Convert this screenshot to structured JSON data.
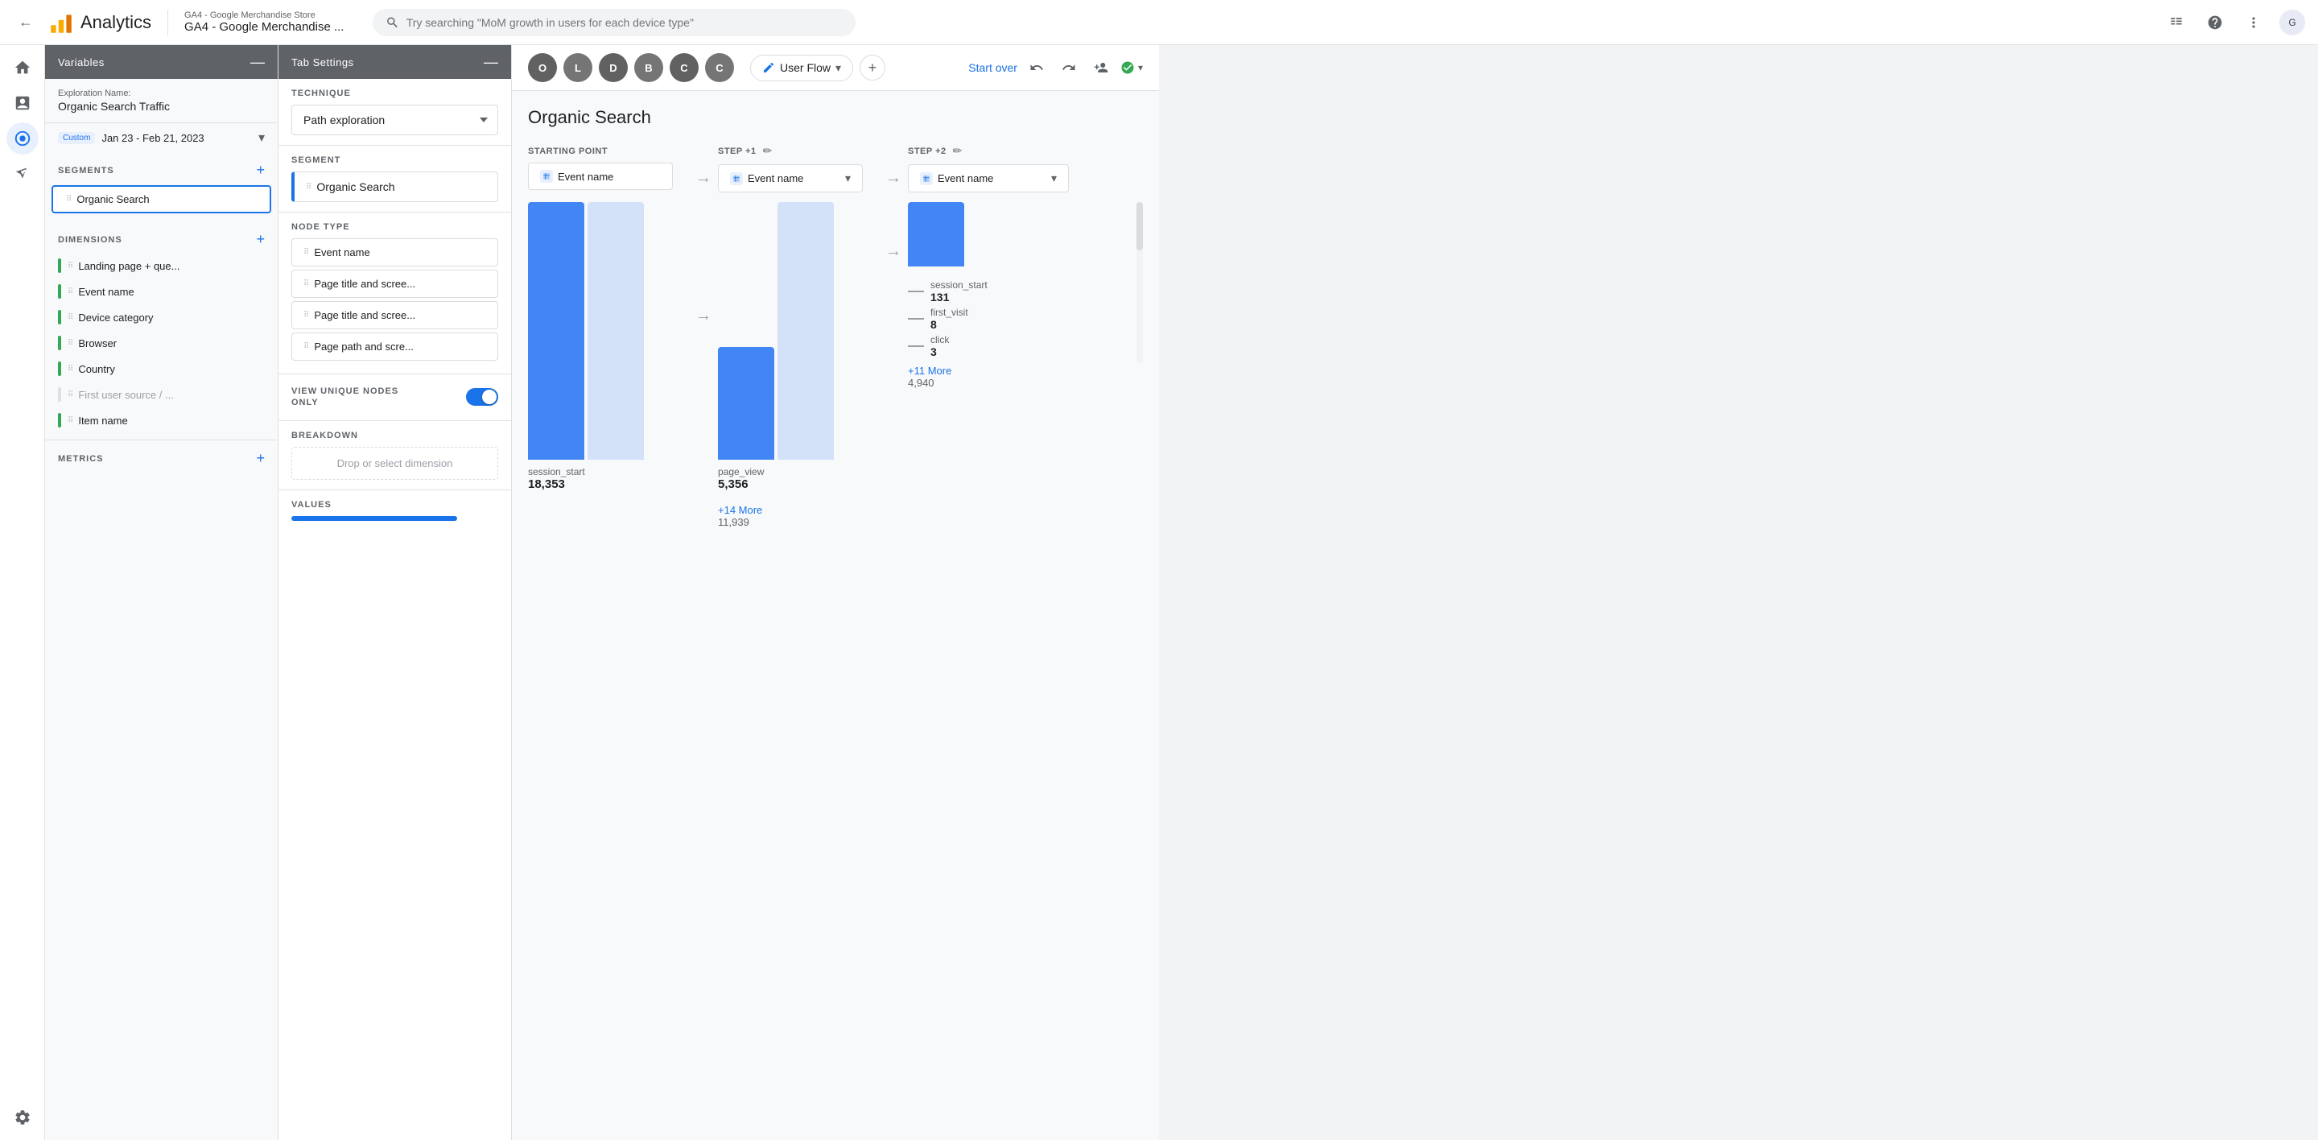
{
  "topNav": {
    "backLabel": "←",
    "logoAlt": "Analytics logo",
    "appTitle": "Analytics",
    "accountName": "GA4 - Google Merchandise Store",
    "propertyName": "GA4 - Google Merchandise ...",
    "searchPlaceholder": "Try searching \"MoM growth in users for each device type\"",
    "icons": {
      "grid": "⊞",
      "help": "?",
      "more": "⋮"
    }
  },
  "leftSidebar": {
    "items": [
      {
        "name": "home",
        "icon": "⌂",
        "active": false
      },
      {
        "name": "reports",
        "icon": "📊",
        "active": false
      },
      {
        "name": "explore",
        "icon": "○",
        "active": true
      },
      {
        "name": "advertising",
        "icon": "📡",
        "active": false
      },
      {
        "name": "admin",
        "icon": "⚙",
        "active": false
      }
    ]
  },
  "variablesPanel": {
    "title": "Variables",
    "minimizeLabel": "—",
    "explorationNameLabel": "Exploration Name:",
    "explorationNameValue": "Organic Search Traffic",
    "dateRange": {
      "badge": "Custom",
      "value": "Jan 23 - Feb 21, 2023"
    },
    "segments": {
      "title": "SEGMENTS",
      "items": [
        {
          "label": "Organic Search",
          "active": true
        }
      ]
    },
    "dimensions": {
      "title": "DIMENSIONS",
      "items": [
        {
          "label": "Landing page + que...",
          "muted": false
        },
        {
          "label": "Event name",
          "muted": false
        },
        {
          "label": "Device category",
          "muted": false
        },
        {
          "label": "Browser",
          "muted": false
        },
        {
          "label": "Country",
          "muted": false
        },
        {
          "label": "First user source / ...",
          "muted": true
        },
        {
          "label": "Item name",
          "muted": false
        }
      ]
    },
    "metrics": {
      "title": "METRICS"
    }
  },
  "tabSettings": {
    "title": "Tab Settings",
    "minimizeLabel": "—",
    "technique": {
      "label": "TECHNIQUE",
      "value": "Path exploration"
    },
    "segment": {
      "label": "SEGMENT",
      "value": "Organic Search"
    },
    "nodeType": {
      "label": "NODE TYPE",
      "items": [
        "Event name",
        "Page title and scree...",
        "Page title and scree...",
        "Page path and scre..."
      ]
    },
    "viewUniqueNodes": {
      "label": "VIEW UNIQUE NODES\nONLY",
      "enabled": true
    },
    "breakdown": {
      "label": "BREAKDOWN",
      "placeholder": "Drop or select dimension"
    },
    "values": {
      "label": "VALUES"
    }
  },
  "explorationToolbar": {
    "users": [
      {
        "initial": "O",
        "color": "#5f6368"
      },
      {
        "initial": "L",
        "color": "#5f6368"
      },
      {
        "initial": "D",
        "color": "#5f6368"
      },
      {
        "initial": "B",
        "color": "#5f6368"
      },
      {
        "initial": "C",
        "color": "#5f6368"
      },
      {
        "initial": "C",
        "color": "#5f6368"
      }
    ],
    "technique": {
      "icon": "✏",
      "label": "User Flow"
    },
    "addTab": "+",
    "startOver": "Start over",
    "undoIcon": "↩",
    "redoIcon": "↪",
    "addUserIcon": "👤+",
    "savedLabel": "✓",
    "savedMore": "▾"
  },
  "flowChart": {
    "title": "Organic Search",
    "steps": [
      {
        "label": "STARTING POINT",
        "dimension": "Event name",
        "showEdit": false
      },
      {
        "label": "STEP +1",
        "dimension": "Event name",
        "showEdit": true
      },
      {
        "label": "STEP +2",
        "dimension": "Event name",
        "showEdit": true
      }
    ],
    "startingPoint": {
      "name": "session_start",
      "value": "18,353",
      "barHeight": 300
    },
    "step1": {
      "topNode": {
        "name": "page_view",
        "value": "5,356",
        "barHeight": 130
      },
      "moreLink": "+14 More",
      "moreValue": "11,939"
    },
    "step2": {
      "nodes": [
        {
          "name": "session_start",
          "value": "131"
        },
        {
          "name": "first_visit",
          "value": "8"
        },
        {
          "name": "click",
          "value": "3"
        }
      ],
      "moreLink": "+11 More",
      "moreValue": "4,940",
      "barHeight": 80
    }
  }
}
